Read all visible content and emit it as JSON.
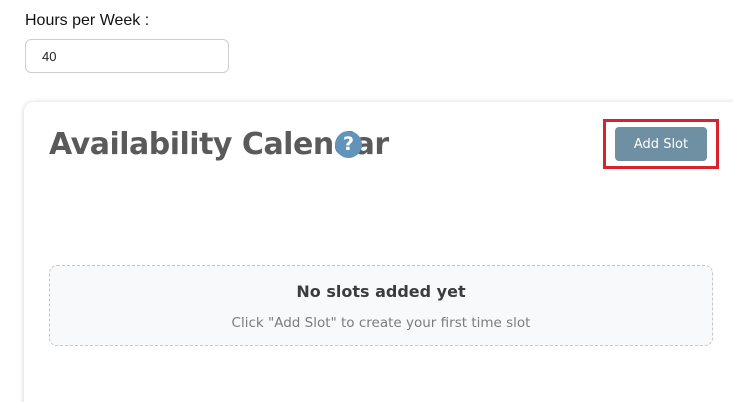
{
  "hours": {
    "label": "Hours per Week :",
    "value": "40"
  },
  "calendar": {
    "title": "Availability Calendar",
    "help_icon_glyph": "?",
    "add_slot_label": "Add Slot",
    "empty_state": {
      "title": "No slots added yet",
      "subtitle": "Click \"Add Slot\" to create your first time slot"
    }
  },
  "colors": {
    "help_icon": "#6193bb",
    "button": "#6f8fa3",
    "highlight": "#d9232c"
  },
  "icons": {
    "help": "help-icon"
  }
}
